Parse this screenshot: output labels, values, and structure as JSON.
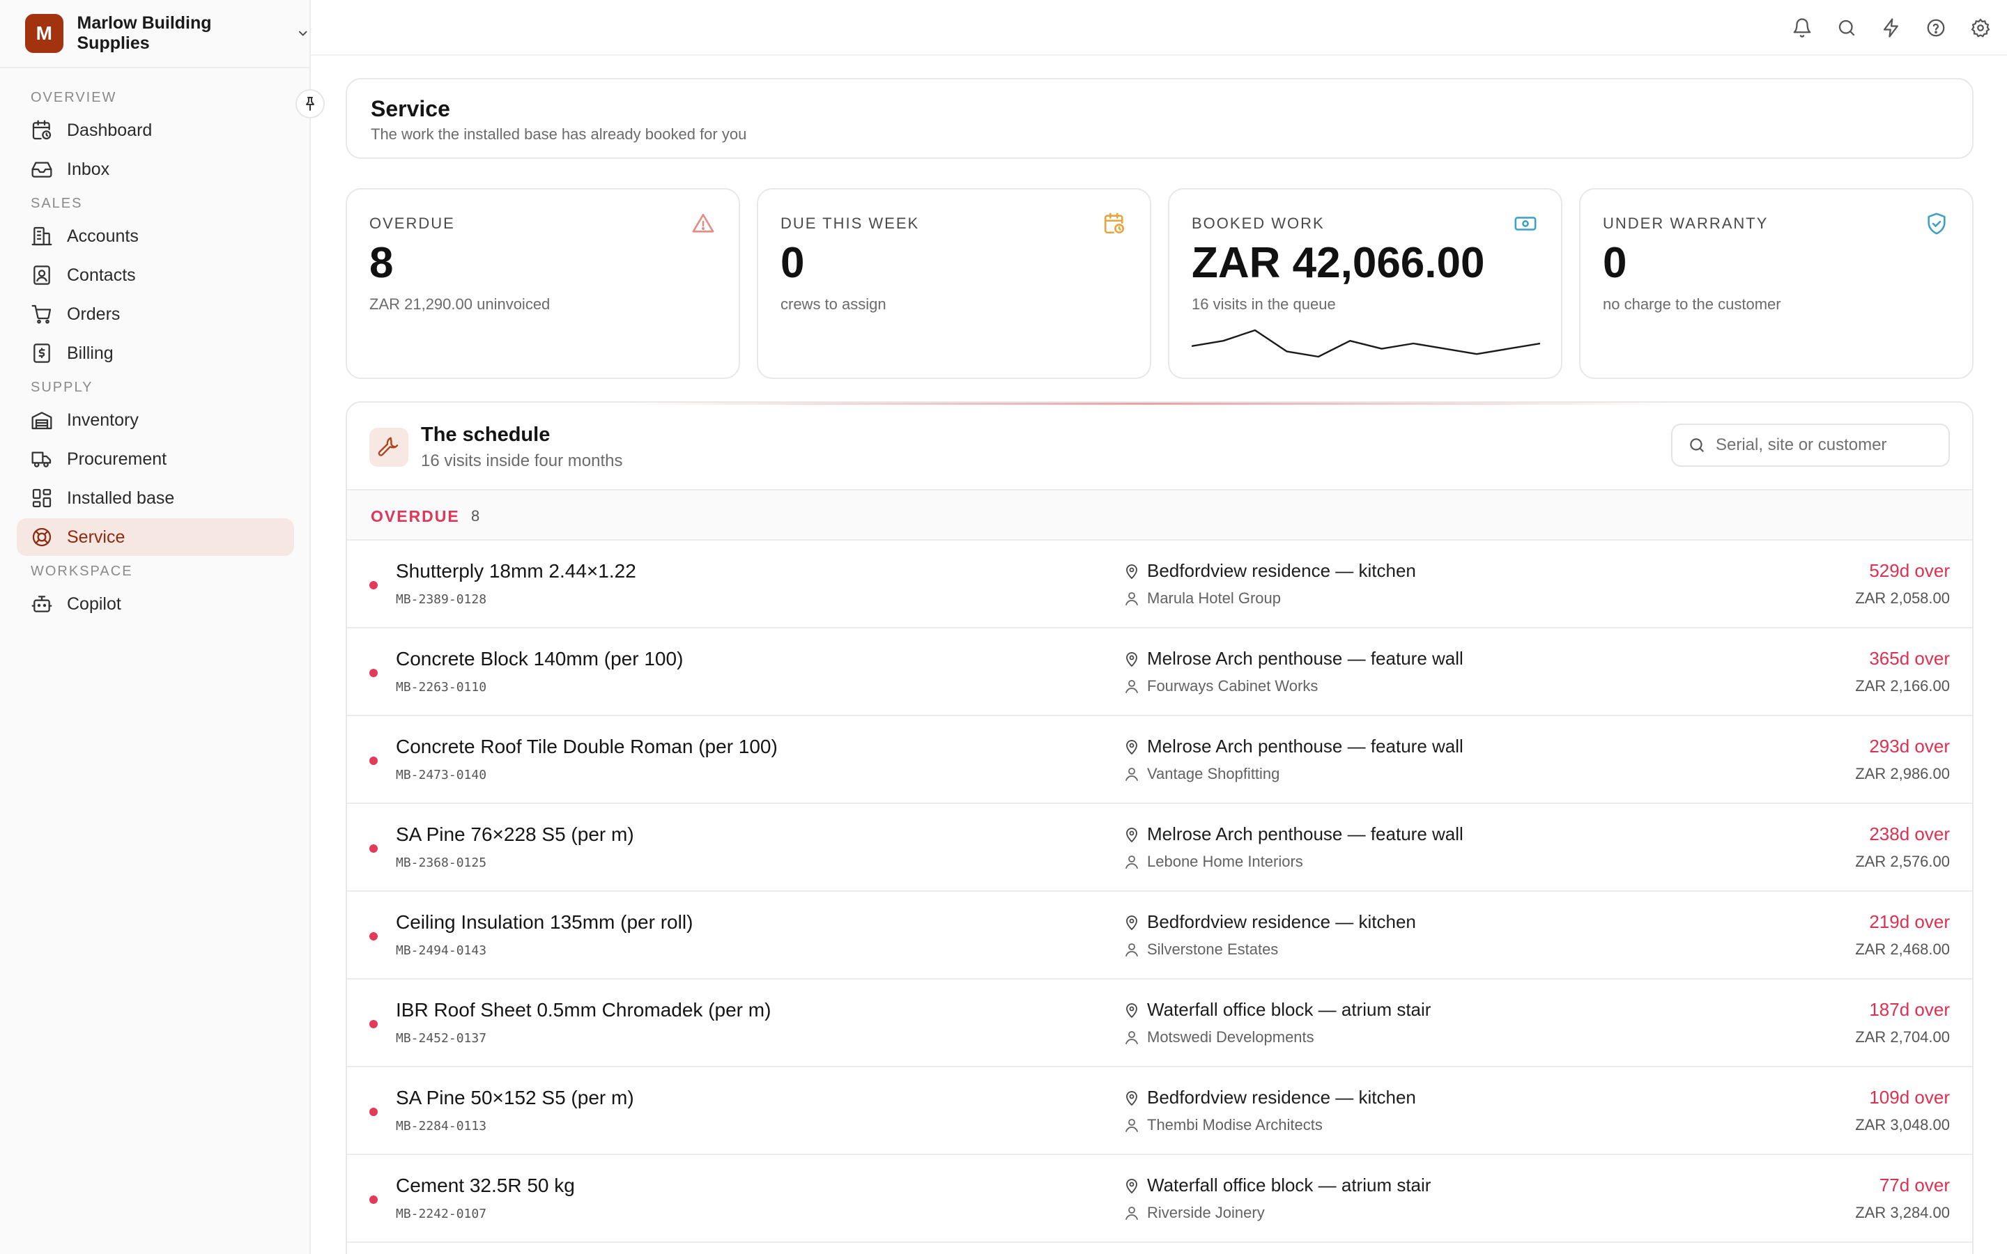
{
  "brand": {
    "initial": "M",
    "name": "Marlow Building Supplies"
  },
  "nav": {
    "sections": [
      {
        "title": "OVERVIEW",
        "items": [
          {
            "label": "Dashboard",
            "icon": "calendar-clock-icon"
          },
          {
            "label": "Inbox",
            "icon": "inbox-icon"
          }
        ]
      },
      {
        "title": "SALES",
        "items": [
          {
            "label": "Accounts",
            "icon": "building-icon"
          },
          {
            "label": "Contacts",
            "icon": "contact-card-icon"
          },
          {
            "label": "Orders",
            "icon": "cart-icon"
          },
          {
            "label": "Billing",
            "icon": "dollar-receipt-icon"
          }
        ]
      },
      {
        "title": "SUPPLY",
        "items": [
          {
            "label": "Inventory",
            "icon": "warehouse-icon"
          },
          {
            "label": "Procurement",
            "icon": "truck-icon"
          },
          {
            "label": "Installed base",
            "icon": "grid-icon"
          },
          {
            "label": "Service",
            "icon": "lifebuoy-icon",
            "active": true
          }
        ]
      },
      {
        "title": "WORKSPACE",
        "items": [
          {
            "label": "Copilot",
            "icon": "bot-icon"
          }
        ]
      }
    ]
  },
  "page": {
    "title": "Service",
    "subtitle": "The work the installed base has already booked for you"
  },
  "stats": [
    {
      "label": "OVERDUE",
      "value": "8",
      "note": "ZAR 21,290.00 uninvoiced",
      "icon": "warning-triangle-icon",
      "color": "#e58a84"
    },
    {
      "label": "DUE THIS WEEK",
      "value": "0",
      "note": "crews to assign",
      "icon": "calendar-clock-icon",
      "color": "#e8a33c"
    },
    {
      "label": "BOOKED WORK",
      "value": "ZAR 42,066.00",
      "note": "16 visits in the queue",
      "icon": "banknote-icon",
      "color": "#3aa0c8"
    },
    {
      "label": "UNDER WARRANTY",
      "value": "0",
      "note": "no charge to the customer",
      "icon": "shield-check-icon",
      "color": "#3aa0c8"
    }
  ],
  "sparkline": [
    3,
    4,
    6,
    2,
    1,
    4,
    2.5,
    3.5,
    2.5,
    1.5,
    2.5,
    3.5
  ],
  "schedule": {
    "title": "The schedule",
    "subtitle": "16 visits inside four months",
    "search_placeholder": "Serial, site or customer",
    "group": {
      "label": "OVERDUE",
      "count": "8"
    },
    "rows": [
      {
        "name": "Shutterply 18mm 2.44×1.22",
        "serial": "MB-2389-0128",
        "site": "Bedfordview residence — kitchen",
        "customer": "Marula Hotel Group",
        "overdue": "529d over",
        "amount": "ZAR 2,058.00"
      },
      {
        "name": "Concrete Block 140mm (per 100)",
        "serial": "MB-2263-0110",
        "site": "Melrose Arch penthouse — feature wall",
        "customer": "Fourways Cabinet Works",
        "overdue": "365d over",
        "amount": "ZAR 2,166.00"
      },
      {
        "name": "Concrete Roof Tile Double Roman (per 100)",
        "serial": "MB-2473-0140",
        "site": "Melrose Arch penthouse — feature wall",
        "customer": "Vantage Shopfitting",
        "overdue": "293d over",
        "amount": "ZAR 2,986.00"
      },
      {
        "name": "SA Pine 76×228 S5 (per m)",
        "serial": "MB-2368-0125",
        "site": "Melrose Arch penthouse — feature wall",
        "customer": "Lebone Home Interiors",
        "overdue": "238d over",
        "amount": "ZAR 2,576.00"
      },
      {
        "name": "Ceiling Insulation 135mm (per roll)",
        "serial": "MB-2494-0143",
        "site": "Bedfordview residence — kitchen",
        "customer": "Silverstone Estates",
        "overdue": "219d over",
        "amount": "ZAR 2,468.00"
      },
      {
        "name": "IBR Roof Sheet 0.5mm Chromadek (per m)",
        "serial": "MB-2452-0137",
        "site": "Waterfall office block — atrium stair",
        "customer": "Motswedi Developments",
        "overdue": "187d over",
        "amount": "ZAR 2,704.00"
      },
      {
        "name": "SA Pine 50×152 S5 (per m)",
        "serial": "MB-2284-0113",
        "site": "Bedfordview residence — kitchen",
        "customer": "Thembi Modise Architects",
        "overdue": "109d over",
        "amount": "ZAR 3,048.00"
      },
      {
        "name": "Cement 32.5R 50 kg",
        "serial": "MB-2242-0107",
        "site": "Waterfall office block — atrium stair",
        "customer": "Riverside Joinery",
        "overdue": "77d over",
        "amount": "ZAR 3,284.00"
      }
    ]
  },
  "colors": {
    "brand": "#a3330f",
    "accent_active_bg": "#f7e7e3",
    "overdue_red": "#e03052"
  }
}
